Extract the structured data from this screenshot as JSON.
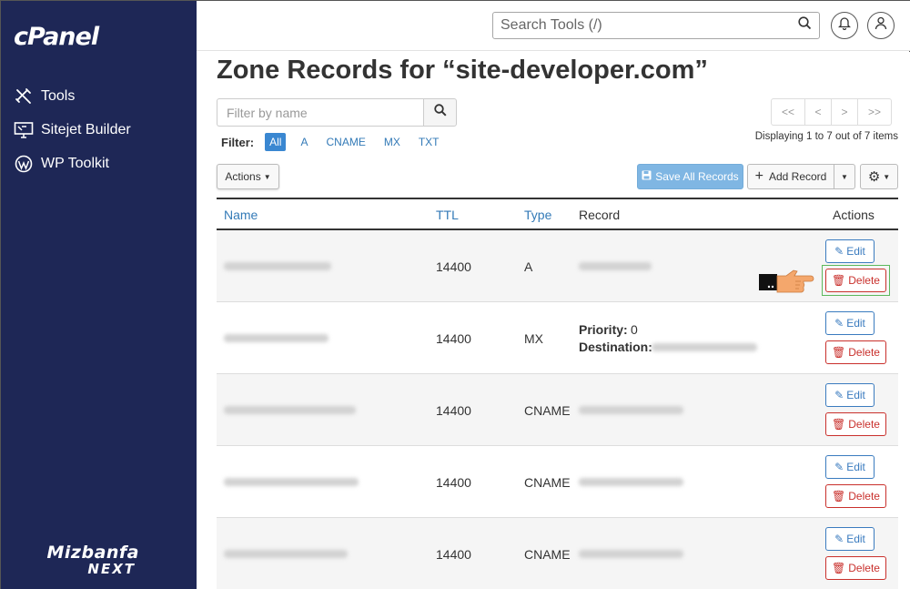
{
  "sidebar": {
    "logo": "cPanel",
    "items": [
      {
        "label": "Tools",
        "icon": "tools-icon"
      },
      {
        "label": "Sitejet Builder",
        "icon": "monitor-icon"
      },
      {
        "label": "WP Toolkit",
        "icon": "wordpress-icon"
      }
    ],
    "brand_line1": "Mizbanfa",
    "brand_line2": "NEXT",
    "bg_color": "#1e2756"
  },
  "topbar": {
    "search_placeholder": "Search Tools (/)"
  },
  "page": {
    "title": "Zone Records for “site-developer.com”",
    "filter_placeholder": "Filter by name",
    "filter_label": "Filter:",
    "filters": [
      "All",
      "A",
      "CNAME",
      "MX",
      "TXT"
    ],
    "active_filter": "All",
    "pager": [
      "<<",
      "<",
      ">",
      ">>"
    ],
    "displaying": "Displaying 1 to 7 out of 7 items",
    "actions_label": "Actions",
    "save_label": "Save All Records",
    "add_label": "Add Record"
  },
  "table": {
    "headers": {
      "name": "Name",
      "ttl": "TTL",
      "type": "Type",
      "record": "Record",
      "actions": "Actions"
    },
    "edit_label": "Edit",
    "delete_label": "Delete",
    "rows": [
      {
        "ttl": "14400",
        "type": "A",
        "priority_label": "",
        "priority": "",
        "destination_label": ""
      },
      {
        "ttl": "14400",
        "type": "MX",
        "priority_label": "Priority:",
        "priority": "0",
        "destination_label": "Destination:"
      },
      {
        "ttl": "14400",
        "type": "CNAME",
        "priority_label": "",
        "priority": "",
        "destination_label": ""
      },
      {
        "ttl": "14400",
        "type": "CNAME",
        "priority_label": "",
        "priority": "",
        "destination_label": ""
      },
      {
        "ttl": "14400",
        "type": "CNAME",
        "priority_label": "",
        "priority": "",
        "destination_label": ""
      }
    ]
  },
  "colors": {
    "link": "#337ab7",
    "delete": "#c9302c",
    "save": "#7fb6e3"
  }
}
